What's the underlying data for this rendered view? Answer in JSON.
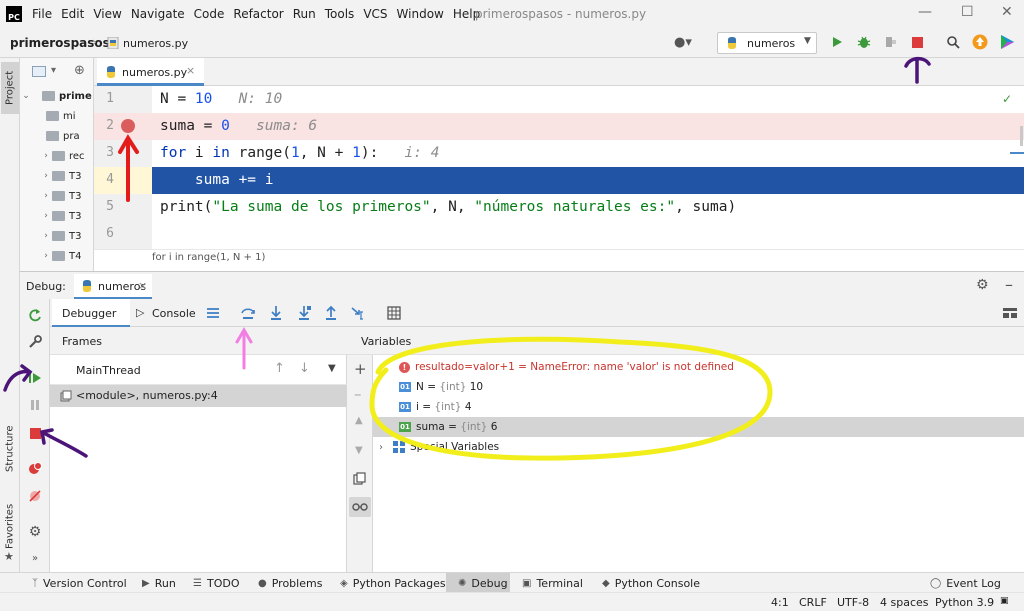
{
  "colors": {
    "accent": "#4a88c7",
    "execution_line": "#2154a5",
    "breakpoint_line": "#fae3e3",
    "breakpoint_dot": "#db5c5c",
    "run_green": "#3c9a3c",
    "stop_red": "#db3b3b",
    "annot_red": "#e31b1b",
    "annot_purple": "#4b1478",
    "annot_pink": "#f27ee3",
    "annot_yellow": "#f2ee1c"
  },
  "menubar": {
    "logo": "PC",
    "items": [
      "File",
      "Edit",
      "View",
      "Navigate",
      "Code",
      "Refactor",
      "Run",
      "Tools",
      "VCS",
      "Window",
      "Help"
    ],
    "window_title": "primerospasos - numeros.py",
    "controls": [
      "—",
      "☐",
      "✕"
    ]
  },
  "navbar": {
    "project": "primerospasos",
    "separator": "›",
    "file": "numeros.py",
    "run_config": "numeros",
    "icons": [
      "user-icon",
      "run-icon",
      "debug-icon",
      "coverage-icon",
      "stop-icon",
      "search-icon",
      "update-icon",
      "jetbrains-icon"
    ]
  },
  "left_stripe": {
    "project_tab": "Project",
    "structure_tab": "Structure",
    "favorites_tab": "Favorites"
  },
  "project_tree": {
    "root": "prime",
    "items": [
      {
        "label": "mi",
        "arrow": ""
      },
      {
        "label": "pra",
        "arrow": ""
      },
      {
        "label": "rec",
        "arrow": "›"
      },
      {
        "label": "T3",
        "arrow": "›"
      },
      {
        "label": "T3",
        "arrow": "›"
      },
      {
        "label": "T3",
        "arrow": "›"
      },
      {
        "label": "T3",
        "arrow": "›"
      },
      {
        "label": "T4",
        "arrow": "›"
      }
    ]
  },
  "editor": {
    "tab_label": "numeros.py",
    "tab_close": "×",
    "line_numbers": [
      "1",
      "2",
      "3",
      "4",
      "5",
      "6"
    ],
    "lines": {
      "l1_a": "N = ",
      "l1_b": "10",
      "l1_inline": "N: 10",
      "l2_a": "suma = ",
      "l2_b": "0",
      "l2_inline": "suma: 6",
      "l3_kw1": "for",
      "l3_a": " i ",
      "l3_kw2": "in",
      "l3_b": " range(",
      "l3_n1": "1",
      "l3_c": ", N + ",
      "l3_n2": "1",
      "l3_d": "):",
      "l3_inline": "i: 4",
      "l4": "    suma += i",
      "l5_a": "print(",
      "l5_s1": "\"La suma de los primeros\"",
      "l5_b": ", N, ",
      "l5_s2": "\"números naturales es:\"",
      "l5_c": ", suma)"
    },
    "breadcrumb": "for i in range(1, N + 1)",
    "check": "✓"
  },
  "debug": {
    "label": "Debug:",
    "session": "numeros",
    "tabs": {
      "debugger": "Debugger",
      "console": "Console"
    },
    "frames_header": "Frames",
    "thread": "MainThread",
    "frame": "<module>, numeros.py:4",
    "variables_header": "Variables",
    "variables": [
      {
        "kind": "error",
        "text": "resultado=valor+1 = NameError: name 'valor' is not defined"
      },
      {
        "kind": "var",
        "name": "N",
        "type": "{int}",
        "value": "10"
      },
      {
        "kind": "var",
        "name": "i",
        "type": "{int}",
        "value": "4"
      },
      {
        "kind": "var",
        "name": "suma",
        "type": "{int}",
        "value": "6"
      },
      {
        "kind": "special",
        "text": "Special Variables"
      }
    ],
    "badge": "01",
    "err_badge": "!"
  },
  "bottom_tabs": [
    "Version Control",
    "Run",
    "TODO",
    "Problems",
    "Python Packages",
    "Debug",
    "Terminal",
    "Python Console"
  ],
  "event_log": "Event Log",
  "status": {
    "position": "4:1",
    "line_sep": "CRLF",
    "encoding": "UTF-8",
    "indent": "4 spaces",
    "interpreter": "Python 3.9"
  }
}
